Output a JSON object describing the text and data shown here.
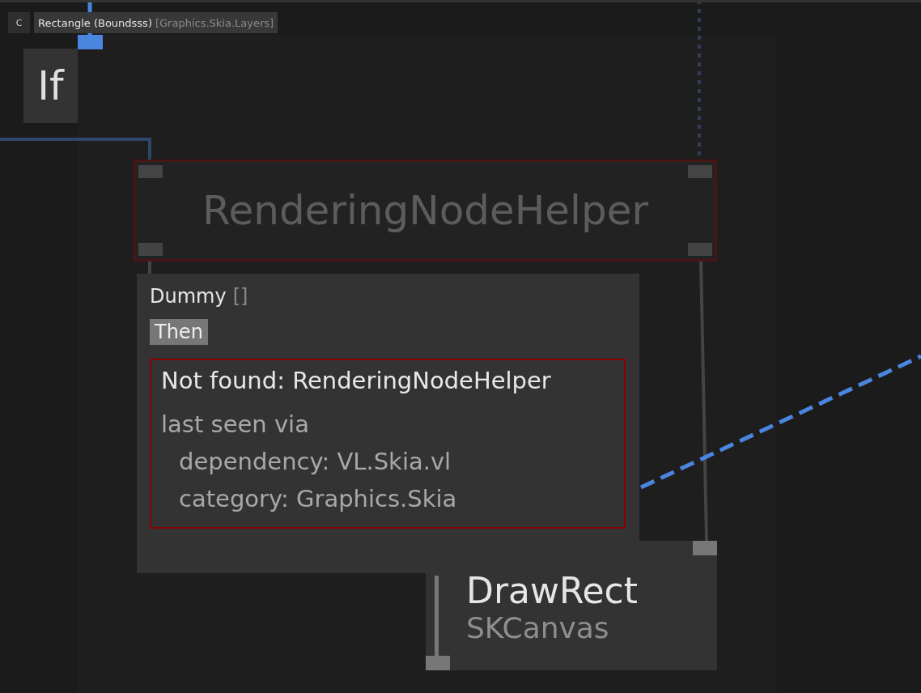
{
  "tooltip_bar": {
    "badge": "C",
    "title": "Rectangle (Boundsss)",
    "category": "[Graphics.Skia.Layers]"
  },
  "nodes": [
    {
      "kind": "if",
      "label": "If"
    },
    {
      "kind": "missing",
      "label": "RenderingNodeHelper"
    },
    {
      "kind": "node",
      "label": "DrawRect",
      "subtitle": "SKCanvas"
    }
  ],
  "tooltip": {
    "title": "Dummy",
    "suffix": "[]",
    "pin": "Then",
    "error": {
      "heading": "Not found: RenderingNodeHelper",
      "intro": "last seen via",
      "details": [
        "dependency: VL.Skia.vl",
        "category: Graphics.Skia"
      ]
    }
  }
}
